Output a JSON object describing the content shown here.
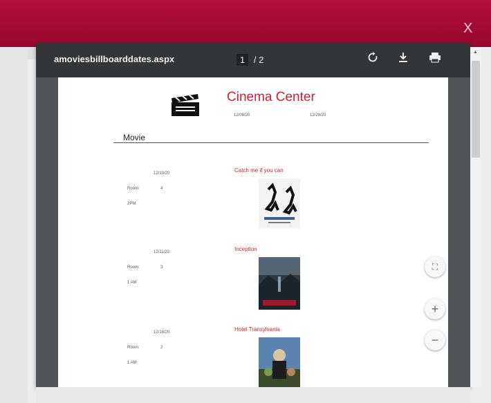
{
  "modal": {
    "close_label": "X"
  },
  "viewer": {
    "file_name": "amoviesbillboarddates.aspx",
    "page_current": "1",
    "page_separator": "/",
    "page_total": "2",
    "icons": {
      "rotate": "rotate-icon",
      "download": "download-icon",
      "print": "print-icon"
    }
  },
  "document": {
    "title": "Cinema Center",
    "date_start": "12/09/20",
    "date_end": "12/29/20",
    "section_header": "Movie",
    "entries": [
      {
        "date": "12/10/20",
        "room_label": "Room:",
        "room_number": "4",
        "time": "2PM",
        "title": "Catch me if you can"
      },
      {
        "date": "12/11/20",
        "room_label": "Room:",
        "room_number": "3",
        "time": "1 AM",
        "title": "Inception"
      },
      {
        "date": "12/18/20",
        "room_label": "Room:",
        "room_number": "2",
        "time": "1 AM",
        "title": "Hotel Transylvania"
      }
    ]
  },
  "controls": {
    "fit_label": "⛶",
    "zoom_in_label": "+",
    "zoom_out_label": "−"
  },
  "colors": {
    "accent": "#b10f3e",
    "title_red": "#d0202e",
    "toolbar": "#323639"
  }
}
